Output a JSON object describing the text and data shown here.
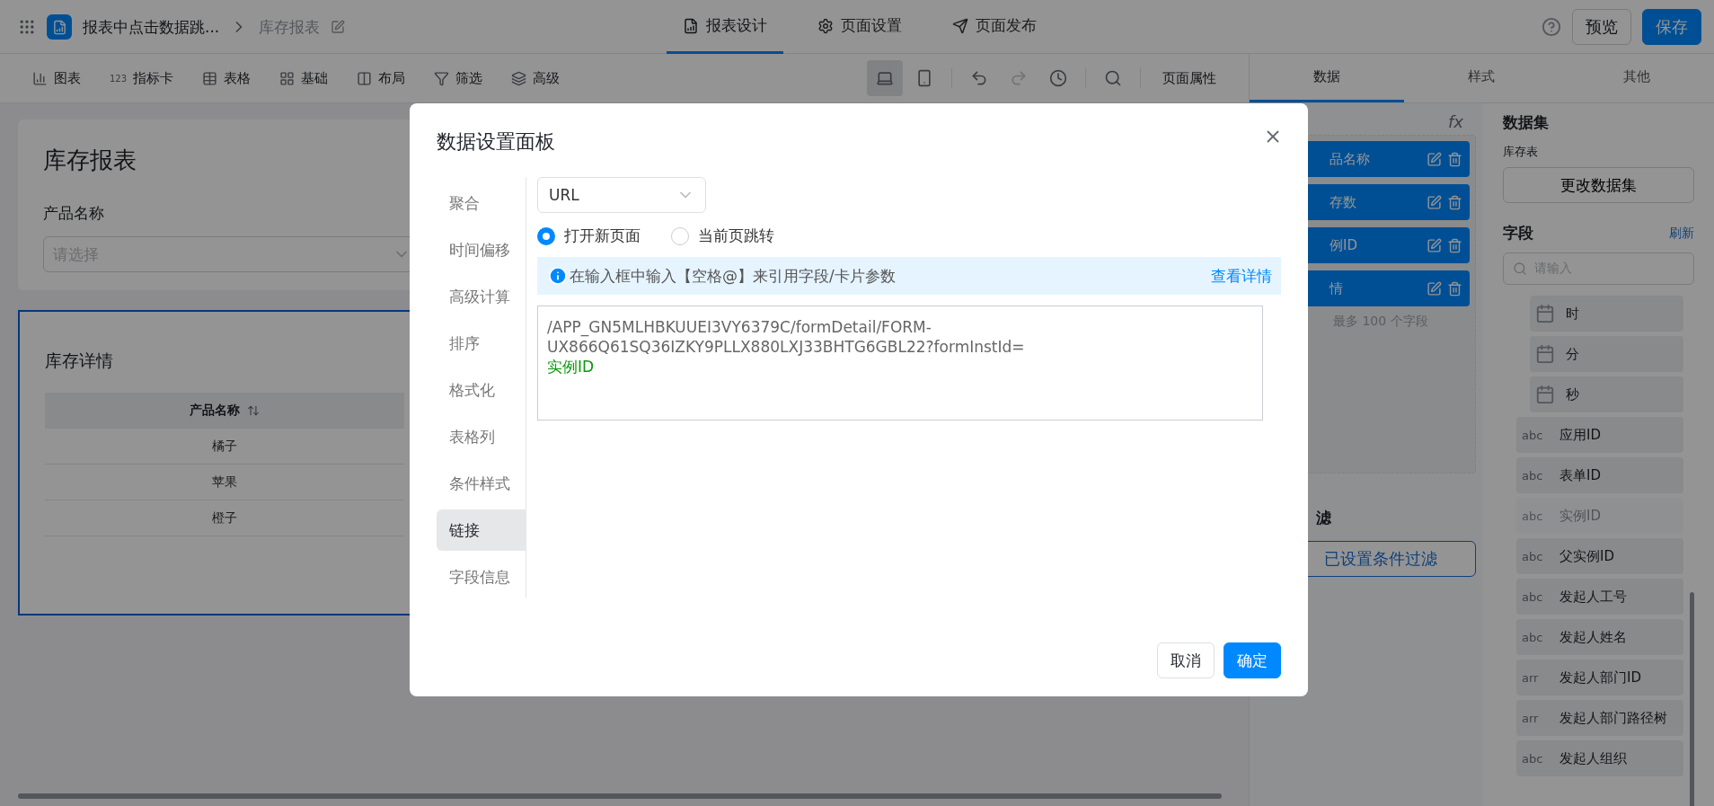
{
  "topbar": {
    "app_title": "报表中点击数据跳...",
    "page_name": "库存报表",
    "tabs": [
      {
        "label": "报表设计",
        "selected": true
      },
      {
        "label": "页面设置",
        "selected": false
      },
      {
        "label": "页面发布",
        "selected": false
      }
    ],
    "preview": "预览",
    "save": "保存"
  },
  "toolbar": {
    "tools": [
      {
        "label": "图表"
      },
      {
        "label": "指标卡",
        "glyph": "123"
      },
      {
        "label": "表格"
      },
      {
        "label": "基础"
      },
      {
        "label": "布局"
      },
      {
        "label": "筛选"
      },
      {
        "label": "高级"
      }
    ],
    "devices": [
      {
        "kind": "desktop",
        "selected": true
      },
      {
        "kind": "mobile",
        "selected": false
      }
    ],
    "history": [
      {
        "kind": "undo",
        "disabled": false
      },
      {
        "kind": "redo",
        "disabled": true
      }
    ],
    "page_properties": "页面属性"
  },
  "canvas": {
    "title": "库存报表",
    "filter_label": "产品名称",
    "filter_placeholder": "请选择",
    "table_title": "库存详情",
    "table": {
      "columns": [
        "产品名称"
      ],
      "rows": [
        [
          "橘子"
        ],
        [
          "苹果"
        ],
        [
          "橙子"
        ]
      ]
    }
  },
  "panel": {
    "tabs": [
      {
        "label": "数据",
        "selected": true
      },
      {
        "label": "样式",
        "selected": false
      },
      {
        "label": "其他",
        "selected": false
      }
    ],
    "formula": "fx",
    "chips": [
      "品名称",
      "存数",
      "例ID",
      "情"
    ],
    "chips_note": "最多 100 个字段",
    "filter_heading": "滤",
    "filter_button": "已设置条件过滤",
    "dataset_heading": "数据集",
    "dataset_name": "库存表",
    "change_dataset": "更改数据集",
    "fields_heading": "字段",
    "refresh": "刷新",
    "search_placeholder": "请输入",
    "fields": [
      {
        "kind": "date",
        "name": "时",
        "disabled": false
      },
      {
        "kind": "date",
        "name": "分",
        "disabled": false
      },
      {
        "kind": "date",
        "name": "秒",
        "disabled": false
      },
      {
        "kind": "typed",
        "type": "abc",
        "name": "应用ID",
        "disabled": false
      },
      {
        "kind": "typed",
        "type": "abc",
        "name": "表单ID",
        "disabled": false
      },
      {
        "kind": "typed",
        "type": "abc",
        "name": "实例ID",
        "disabled": true
      },
      {
        "kind": "typed",
        "type": "abc",
        "name": "父实例ID",
        "disabled": false
      },
      {
        "kind": "typed",
        "type": "abc",
        "name": "发起人工号",
        "disabled": false
      },
      {
        "kind": "typed",
        "type": "abc",
        "name": "发起人姓名",
        "disabled": false
      },
      {
        "kind": "typed",
        "type": "arr",
        "name": "发起人部门ID",
        "disabled": false
      },
      {
        "kind": "typed",
        "type": "arr",
        "name": "发起人部门路径树",
        "disabled": false
      },
      {
        "kind": "typed",
        "type": "abc",
        "name": "发起人组织",
        "disabled": false
      }
    ]
  },
  "dialog": {
    "title": "数据设置面板",
    "menu": [
      {
        "label": "聚合",
        "selected": false
      },
      {
        "label": "时间偏移",
        "selected": false
      },
      {
        "label": "高级计算",
        "selected": false
      },
      {
        "label": "排序",
        "selected": false
      },
      {
        "label": "格式化",
        "selected": false
      },
      {
        "label": "表格列",
        "selected": false
      },
      {
        "label": "条件样式",
        "selected": false
      },
      {
        "label": "链接",
        "selected": true
      },
      {
        "label": "字段信息",
        "selected": false
      }
    ],
    "link_type": "URL",
    "open_modes": [
      {
        "label": "打开新页面",
        "selected": true
      },
      {
        "label": "当前页跳转",
        "selected": false
      }
    ],
    "hint": "在输入框中输入【空格@】来引用字段/卡片参数",
    "hint_link": "查看详情",
    "url_text": "/APP_GN5MLHBKUUEI3VY6379C/formDetail/FORM-UX866Q61SQ36IZKY9PLLX880LXJ33BHTG6GBL22?formInstId=",
    "url_token": "实例ID",
    "cancel": "取消",
    "confirm": "确定"
  }
}
